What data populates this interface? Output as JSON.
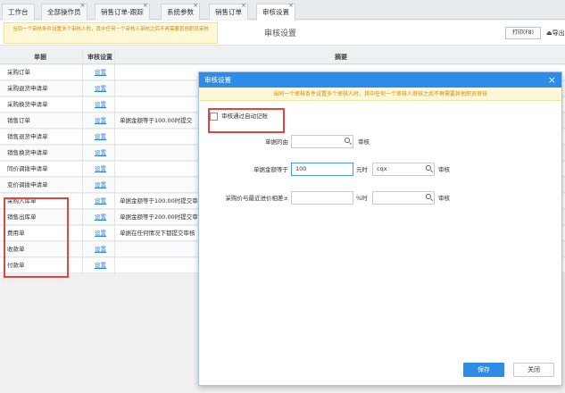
{
  "tabs": [
    {
      "label": "工作台",
      "closable": false
    },
    {
      "label": "全部操作员",
      "closable": true
    },
    {
      "label": "销售订单-跟踪",
      "closable": true
    },
    {
      "label": "系统参数",
      "closable": true
    },
    {
      "label": "销售订单",
      "closable": true
    },
    {
      "label": "审核设置",
      "closable": true,
      "active": true
    }
  ],
  "toolbar": {
    "notice": "当同一个审核条件设置多个审核人时，其中任何一个审核人审核之后不再需要其他职员审核",
    "title": "审核设置",
    "print_label": "打印(F8)",
    "export_label": "导出"
  },
  "table": {
    "headers": {
      "doc": "单据",
      "setting": "审核设置",
      "summary": "摘要"
    },
    "rows": [
      {
        "doc": "采购订单",
        "setting": "设置",
        "summary": ""
      },
      {
        "doc": "采购退货申请单",
        "setting": "设置",
        "summary": ""
      },
      {
        "doc": "采购换货申请单",
        "setting": "设置",
        "summary": ""
      },
      {
        "doc": "销售订单",
        "setting": "设置",
        "summary": "单据金额等于100.00时提交"
      },
      {
        "doc": "销售退货申请单",
        "setting": "设置",
        "summary": ""
      },
      {
        "doc": "销售换货申请单",
        "setting": "设置",
        "summary": ""
      },
      {
        "doc": "同价调拨申请单",
        "setting": "设置",
        "summary": ""
      },
      {
        "doc": "变价调拨申请单",
        "setting": "设置",
        "summary": ""
      },
      {
        "doc": "采购入库单",
        "setting": "设置",
        "summary": "单据金额等于100.00时提交审"
      },
      {
        "doc": "销售出库单",
        "setting": "设置",
        "summary": "单据金额等于200.00时提交审"
      },
      {
        "doc": "费用单",
        "setting": "设置",
        "summary": "单据在任何情况下都提交审核"
      },
      {
        "doc": "收款单",
        "setting": "设置",
        "summary": ""
      },
      {
        "doc": "付款单",
        "setting": "设置",
        "summary": ""
      }
    ]
  },
  "modal": {
    "title": "审核设置",
    "notice": "当同一个审核条件设置多个审核人时，其中任何一个审核人审核之后不再需要其他职员审核",
    "checkbox_label": "审核通过自动记账",
    "checkbox_checked": false,
    "fields": {
      "origin": {
        "label": "单据的由",
        "value": "",
        "suffix": "审核"
      },
      "amount": {
        "label": "单据金额等于",
        "value": "100",
        "unit": "元时",
        "person": "cqx",
        "suffix": "审核"
      },
      "price": {
        "label": "采购价与最近进价相差±",
        "value": "",
        "unit": "%时",
        "person": "",
        "suffix": "审核"
      }
    },
    "save_label": "保存",
    "close_label": "关闭"
  },
  "colors": {
    "accent": "#2d8ce8",
    "notice_text": "#d08a1a",
    "highlight": "#e0463b"
  }
}
